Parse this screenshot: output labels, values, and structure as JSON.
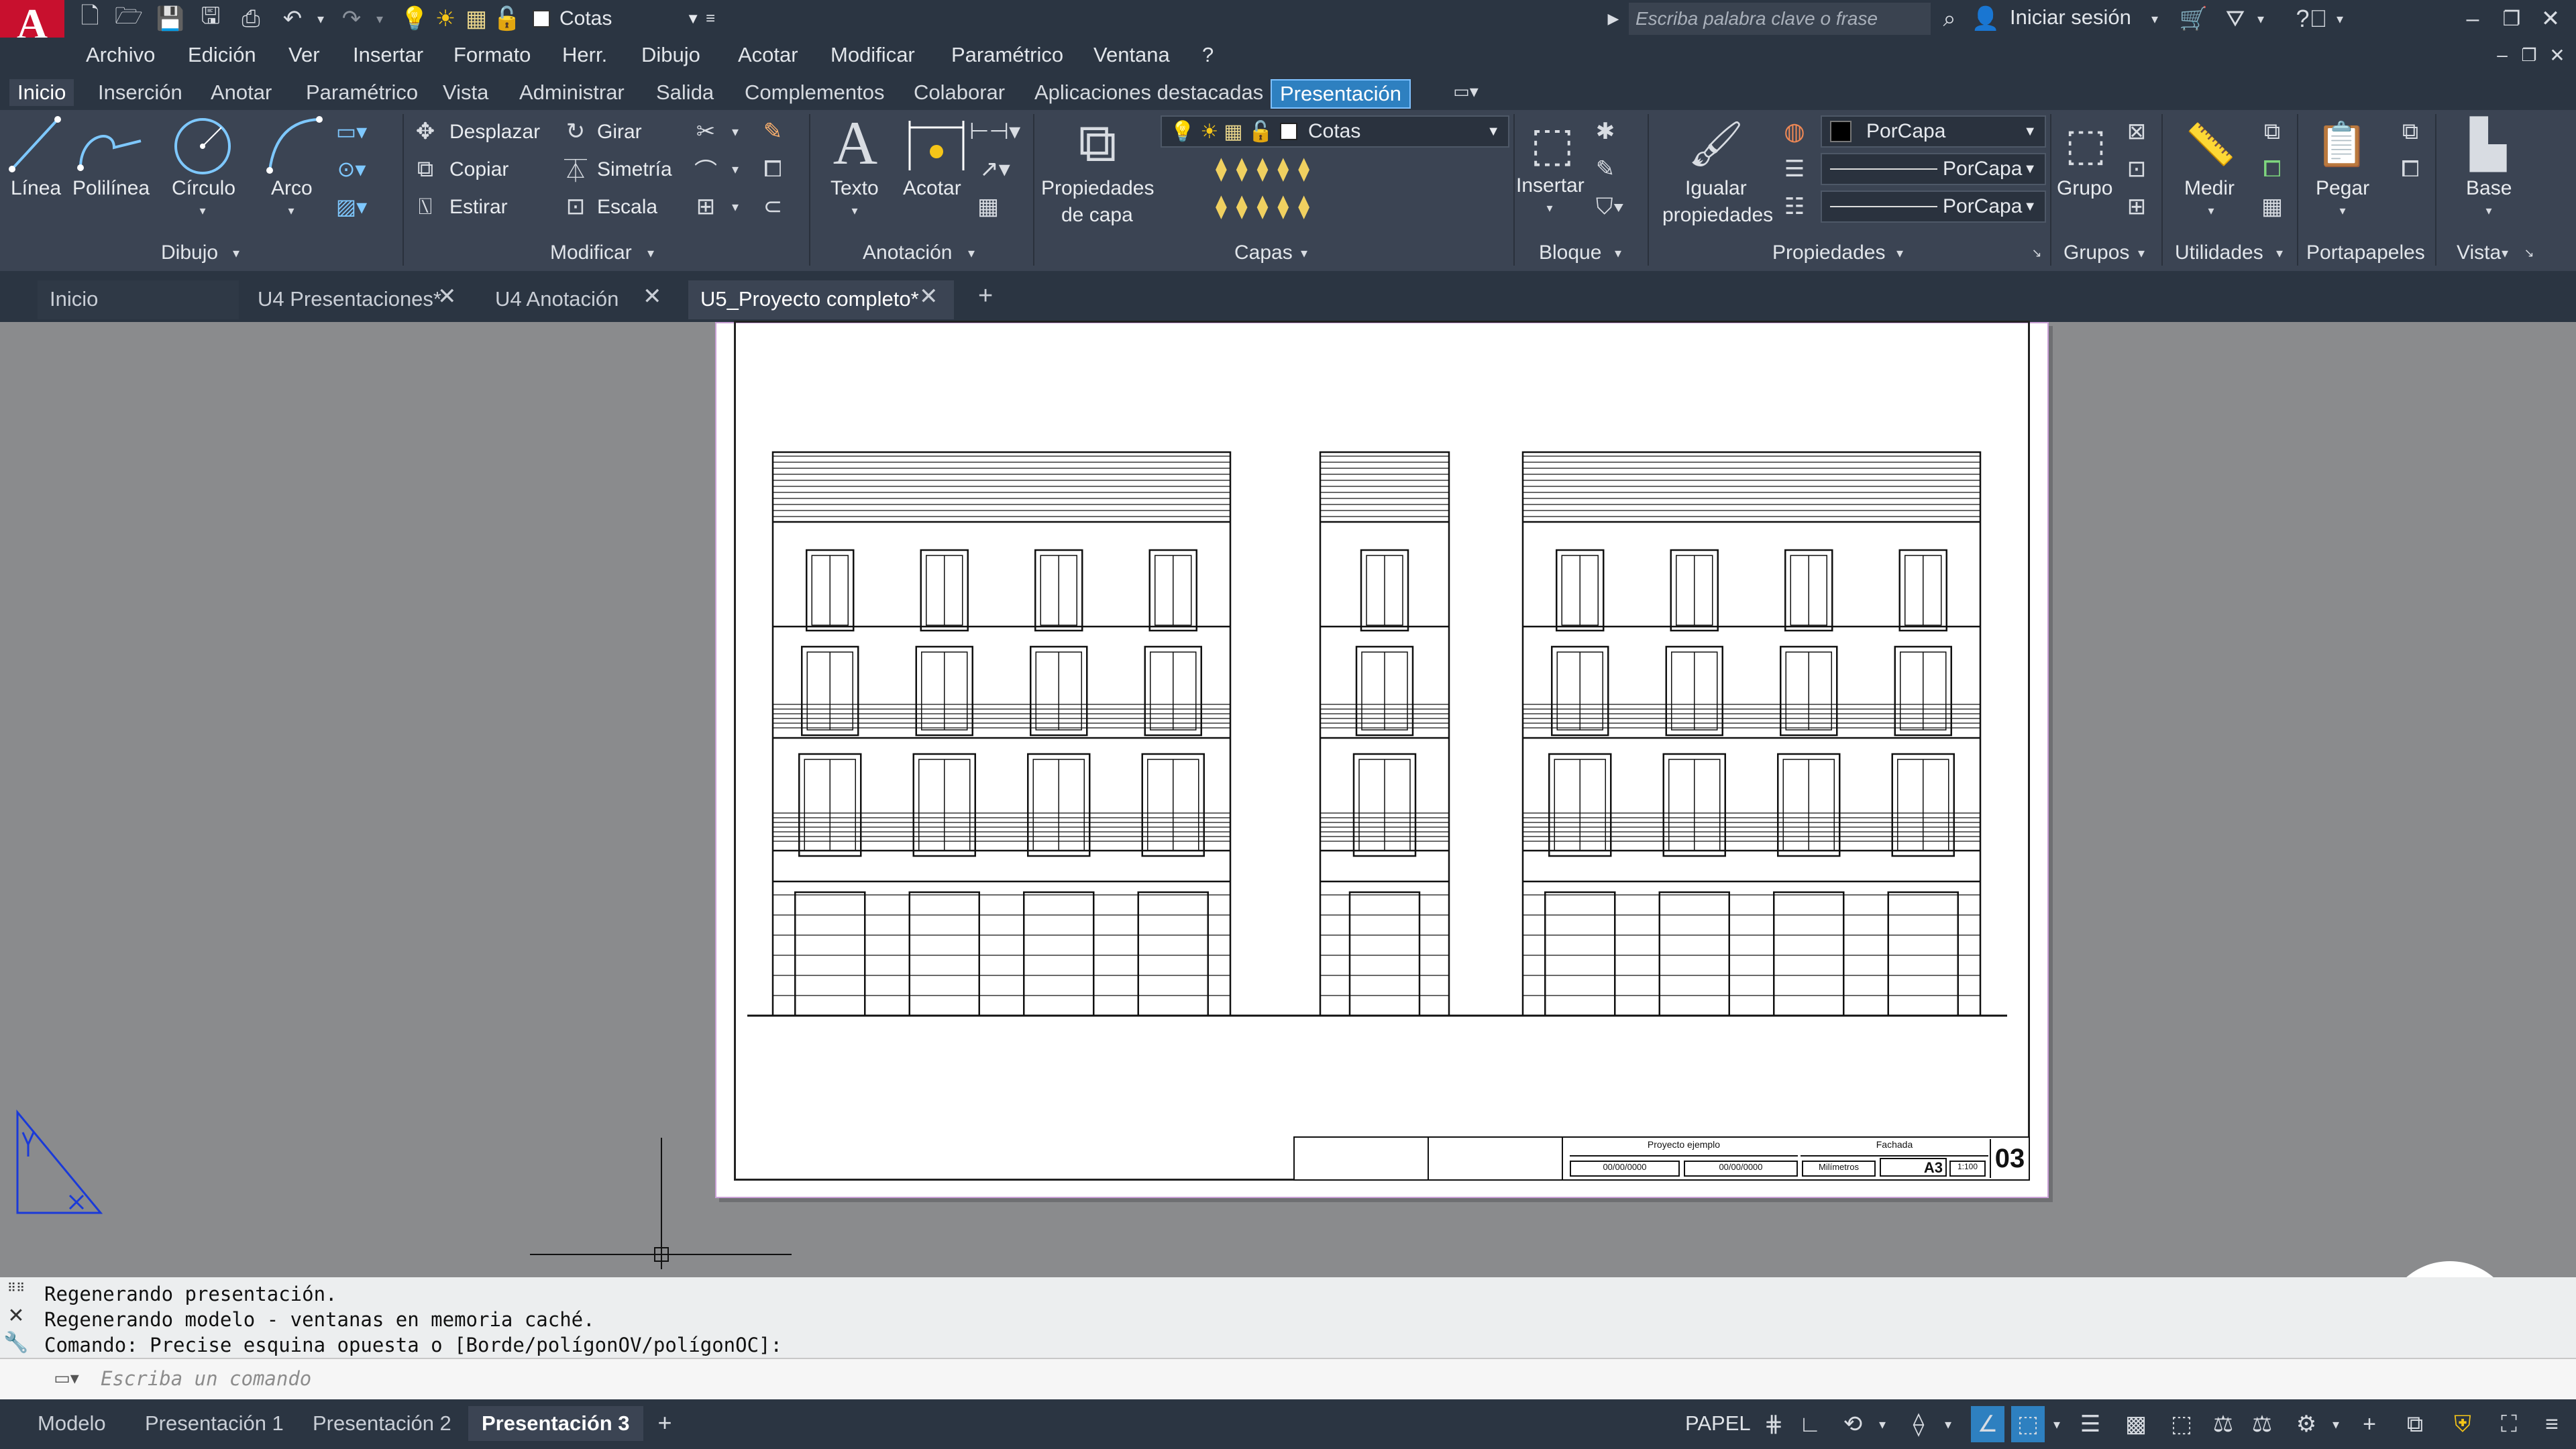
{
  "quick_access": {
    "layer_name": "Cotas"
  },
  "search": {
    "placeholder": "Escriba palabra clave o frase"
  },
  "signin": {
    "label": "Iniciar sesión"
  },
  "menu": [
    "Archivo",
    "Edición",
    "Ver",
    "Insertar",
    "Formato",
    "Herr.",
    "Dibujo",
    "Acotar",
    "Modificar",
    "Paramétrico",
    "Ventana",
    "?"
  ],
  "ribbon_tabs": [
    "Inicio",
    "Inserción",
    "Anotar",
    "Paramétrico",
    "Vista",
    "Administrar",
    "Salida",
    "Complementos",
    "Colaborar",
    "Aplicaciones destacadas",
    "Presentación"
  ],
  "ribbon": {
    "draw": {
      "linea": "Línea",
      "polilinea": "Polilínea",
      "circulo": "Círculo",
      "arco": "Arco",
      "title": "Dibujo"
    },
    "modify": {
      "desplazar": "Desplazar",
      "girar": "Girar",
      "copiar": "Copiar",
      "simetria": "Simetría",
      "estirar": "Estirar",
      "escala": "Escala",
      "title": "Modificar"
    },
    "annotation": {
      "texto": "Texto",
      "acotar": "Acotar",
      "title": "Anotación"
    },
    "layers": {
      "props_line1": "Propiedades",
      "props_line2": "de capa",
      "current": "Cotas",
      "title": "Capas"
    },
    "block": {
      "insertar": "Insertar",
      "title": "Bloque"
    },
    "properties": {
      "igualar1": "Igualar",
      "igualar2": "propiedades",
      "color": "PorCapa",
      "linetype": "PorCapa",
      "lineweight": "PorCapa",
      "title": "Propiedades"
    },
    "groups": {
      "grupo": "Grupo",
      "title": "Grupos"
    },
    "utilities": {
      "medir": "Medir",
      "title": "Utilidades"
    },
    "clipboard": {
      "pegar": "Pegar",
      "title": "Portapapeles"
    },
    "view": {
      "base": "Base",
      "title": "Vista"
    }
  },
  "doc_tabs": [
    {
      "label": "Inicio",
      "closable": false
    },
    {
      "label": "U4 Presentaciones*",
      "closable": true
    },
    {
      "label": "U4 Anotación",
      "closable": true
    },
    {
      "label": "U5_Proyecto completo*",
      "closable": true,
      "active": true
    }
  ],
  "title_block": {
    "project": "Proyecto ejemplo",
    "sheet_title": "Fachada",
    "date1": "00/00/0000",
    "date2": "00/00/0000",
    "units": "Milímetros",
    "size": "A3",
    "scale": "1:100",
    "number": "03"
  },
  "command_history": [
    "Regenerando presentación.",
    "Regenerando modelo - ventanas en memoria caché.",
    "Comando: Precise esquina opuesta o [Borde/polígonOV/polígonOC]:"
  ],
  "command_input": {
    "placeholder": "Escriba un comando"
  },
  "layout_tabs": [
    {
      "label": "Modelo"
    },
    {
      "label": "Presentación 1"
    },
    {
      "label": "Presentación 2"
    },
    {
      "label": "Presentación 3",
      "active": true
    }
  ],
  "status": {
    "space": "PAPEL"
  },
  "colors": {
    "accent": "#2e80c0",
    "logo": "#c8102e",
    "chrome": "#2b3542",
    "ribbon": "#3b4453"
  }
}
